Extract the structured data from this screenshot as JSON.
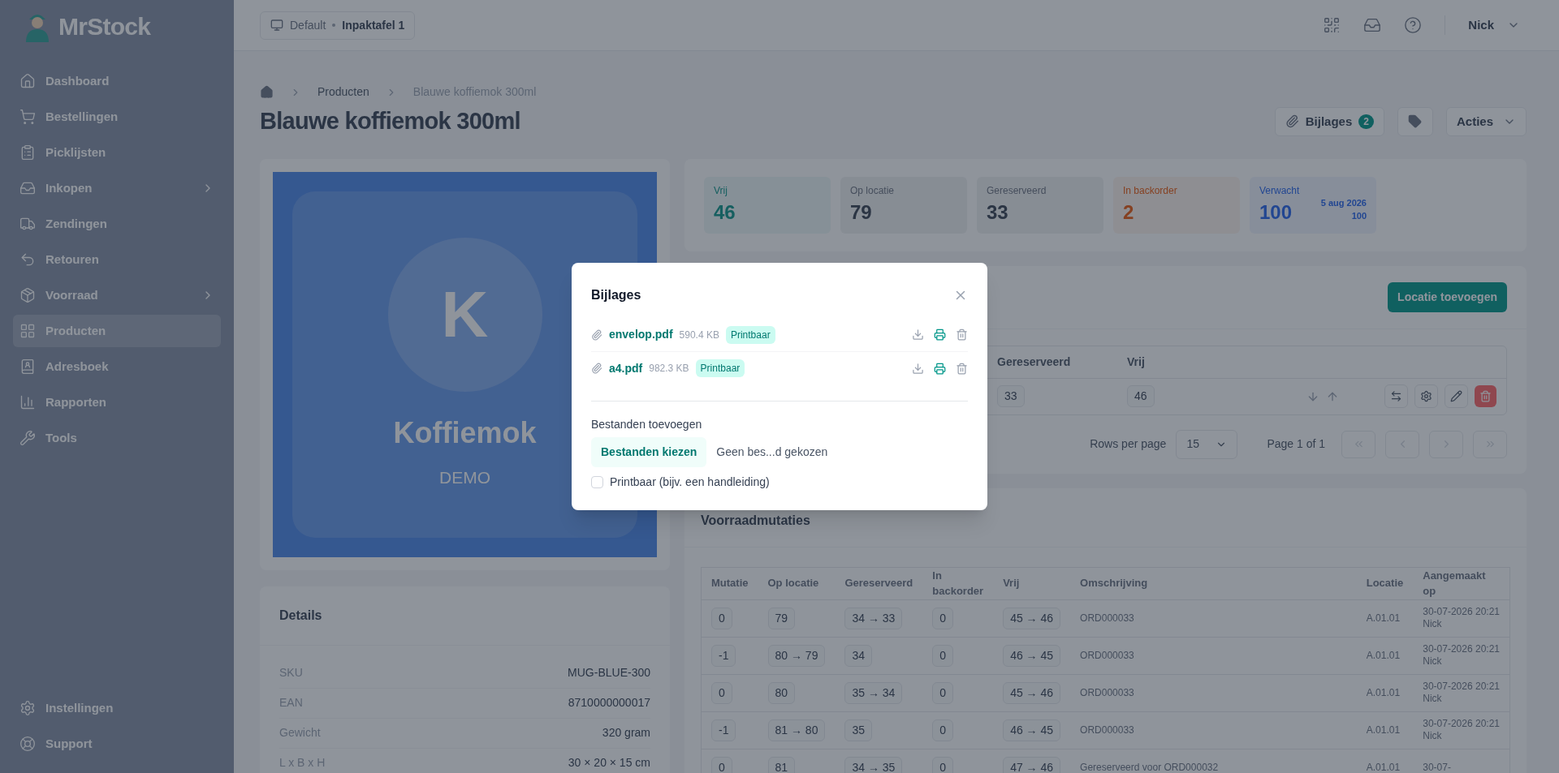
{
  "sidebar": {
    "logo": "MrStock",
    "items": [
      {
        "label": "Dashboard",
        "expandable": false,
        "selected": false
      },
      {
        "label": "Bestellingen",
        "expandable": false,
        "selected": false
      },
      {
        "label": "Picklijsten",
        "expandable": false,
        "selected": false
      },
      {
        "label": "Inkopen",
        "expandable": true,
        "selected": false
      },
      {
        "label": "Zendingen",
        "expandable": false,
        "selected": false
      },
      {
        "label": "Retouren",
        "expandable": false,
        "selected": false
      },
      {
        "label": "Voorraad",
        "expandable": true,
        "selected": false
      },
      {
        "label": "Producten",
        "expandable": false,
        "selected": true
      },
      {
        "label": "Adresboek",
        "expandable": false,
        "selected": false
      },
      {
        "label": "Rapporten",
        "expandable": false,
        "selected": false
      },
      {
        "label": "Tools",
        "expandable": false,
        "selected": false
      }
    ],
    "bottom_items": [
      "Instellingen",
      "Support"
    ]
  },
  "header": {
    "station": "Default",
    "workstation": "Inpaktafel 1",
    "user": "Nick"
  },
  "breadcrumb": [
    "Producten",
    "Blauwe koffiemok 300ml"
  ],
  "title": "Blauwe koffiemok 300ml",
  "actions": {
    "attachments": "Bijlages",
    "attachments_count": "2",
    "menu": "Acties"
  },
  "product_image": {
    "initial": "K",
    "name": "Koffiemok",
    "tag": "DEMO"
  },
  "details": {
    "title": "Details",
    "rows": [
      {
        "label": "SKU",
        "value": "MUG-BLUE-300"
      },
      {
        "label": "EAN",
        "value": "8710000000017"
      },
      {
        "label": "Gewicht",
        "value": "320 gram"
      },
      {
        "label": "L x B x H",
        "value": "30 × 20 × 15 cm"
      }
    ]
  },
  "stats": [
    {
      "label": "Vrij",
      "value": "46",
      "kind": "free"
    },
    {
      "label": "Op locatie",
      "value": "79",
      "kind": "neutral"
    },
    {
      "label": "Gereserveerd",
      "value": "33",
      "kind": "neutral"
    },
    {
      "label": "In backorder",
      "value": "2",
      "kind": "warning"
    },
    {
      "label": "Verwacht",
      "value": "100",
      "kind": "expected",
      "expected_date": "5 aug 2026",
      "expected_qty": "100"
    }
  ],
  "locations": {
    "add_button": "Locatie toevoegen",
    "columns": [
      "Gereserveerd",
      "Vrij"
    ],
    "row": [
      "33",
      "46"
    ],
    "rows_per_page_label": "Rows per page",
    "rows_per_page": "15",
    "page": "Page 1 of 1"
  },
  "mutations": {
    "title": "Voorraadmutaties",
    "columns": [
      "Mutatie",
      "Op locatie",
      "Gereserveerd",
      "In backorder",
      "Vrij",
      "Omschrijving",
      "Locatie",
      "Aangemaakt op"
    ],
    "rows": [
      {
        "mutation": "0",
        "on_location": "79",
        "reserved": "34 → 33",
        "backorder": "0",
        "free": "45 → 46",
        "description": "ORD000033",
        "location": "A.01.01",
        "created": "30-07-2026 20:21",
        "user": "Nick"
      },
      {
        "mutation": "-1",
        "on_location": "80 → 79",
        "reserved": "34",
        "backorder": "0",
        "free": "46 → 45",
        "description": "ORD000033",
        "location": "A.01.01",
        "created": "30-07-2026 20:21",
        "user": "Nick"
      },
      {
        "mutation": "0",
        "on_location": "80",
        "reserved": "35 → 34",
        "backorder": "0",
        "free": "45 → 46",
        "description": "ORD000033",
        "location": "A.01.01",
        "created": "30-07-2026 20:21",
        "user": "Nick"
      },
      {
        "mutation": "-1",
        "on_location": "81 → 80",
        "reserved": "35",
        "backorder": "0",
        "free": "46 → 45",
        "description": "ORD000033",
        "location": "A.01.01",
        "created": "30-07-2026 20:21",
        "user": "Nick"
      },
      {
        "mutation": "0",
        "on_location": "81",
        "reserved": "34 → 35",
        "backorder": "0",
        "free": "47 → 46",
        "description": "Gereserveerd voor ORD000032",
        "location": "A.01.01",
        "created": "30-07-"
      }
    ]
  },
  "modal": {
    "title": "Bijlages",
    "files": [
      {
        "name": "envelop.pdf",
        "size": "590.4 KB",
        "badge": "Printbaar"
      },
      {
        "name": "a4.pdf",
        "size": "982.3 KB",
        "badge": "Printbaar"
      }
    ],
    "add_label": "Bestanden toevoegen",
    "choose_button": "Bestanden kiezen",
    "no_file": "Geen bes...d gekozen",
    "printable": {
      "label": "Printbaar (bijv. een handleiding)",
      "checked": false
    }
  }
}
